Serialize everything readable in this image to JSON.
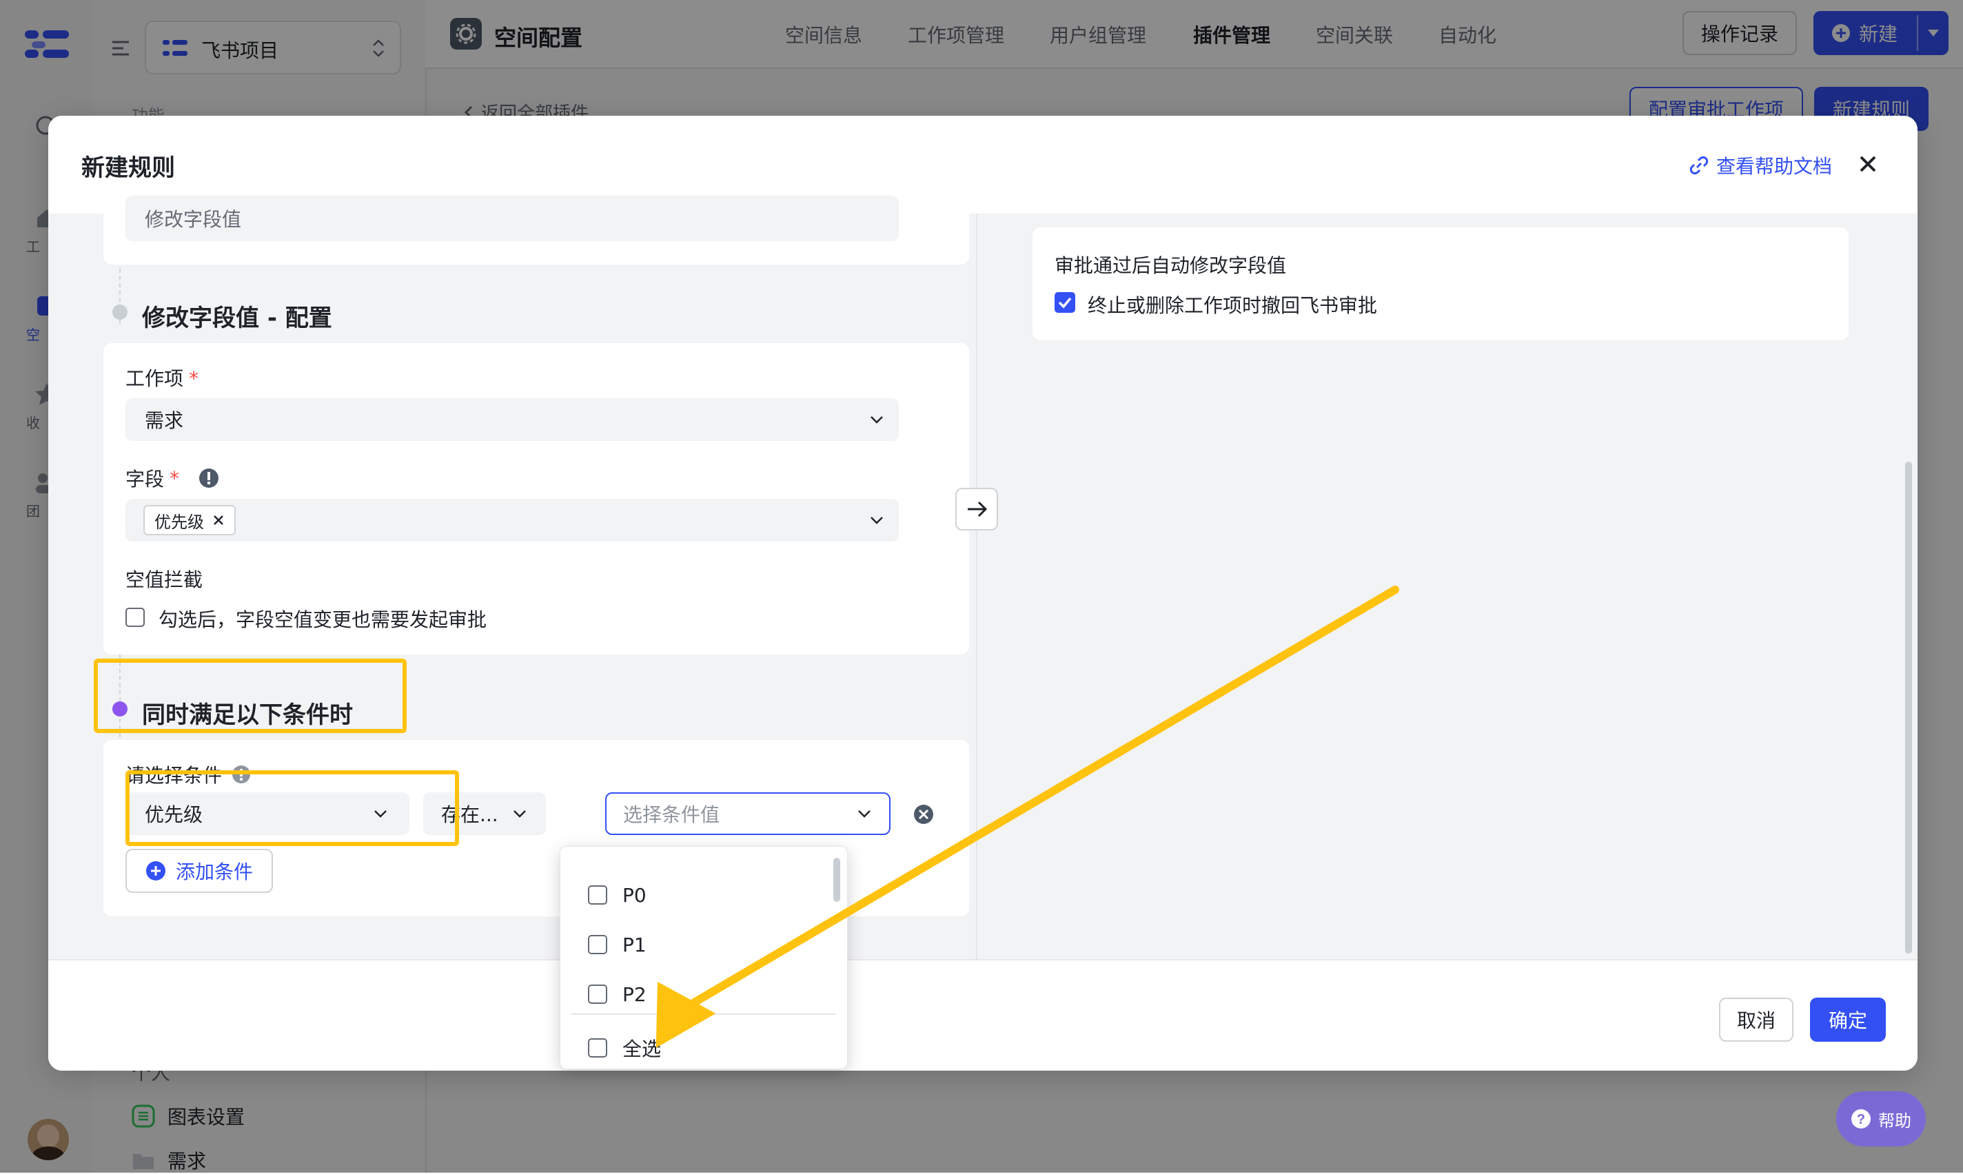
{
  "sidebar": {
    "project_name": "飞书项目",
    "section_label": "功能",
    "rail_labels": [
      "工",
      "空",
      "收",
      "团"
    ],
    "bottom_items": [
      {
        "label": "个人"
      },
      {
        "label": "图表设置"
      },
      {
        "label": "需求"
      }
    ]
  },
  "topbar": {
    "title": "空间配置",
    "tabs": [
      "空间信息",
      "工作项管理",
      "用户组管理",
      "插件管理",
      "空间关联",
      "自动化"
    ],
    "active_tab": "插件管理",
    "history_button": "操作记录",
    "new_button": "新建"
  },
  "page": {
    "back_link": "返回全部插件",
    "config_approval_button": "配置审批工作项",
    "new_rule_button": "新建规则"
  },
  "modal": {
    "title": "新建规则",
    "help_link": "查看帮助文档",
    "top_select_value": "修改字段值",
    "config_section_title": "修改字段值 - 配置",
    "work_item_label": "工作项",
    "work_item_value": "需求",
    "field_label": "字段",
    "field_tag": "优先级",
    "empty_intercept_label": "空值拦截",
    "empty_intercept_checkbox": "勾选后，字段空值变更也需要发起审批",
    "condition_section_title": "同时满足以下条件时",
    "condition_label": "请选择条件",
    "condition_field_value": "优先级",
    "operator_value": "存在...",
    "condition_value_placeholder": "选择条件值",
    "add_condition": "添加条件",
    "dropdown_options": [
      "P0",
      "P1",
      "P2"
    ],
    "select_all": "全选",
    "right_panel_title": "审批通过后自动修改字段值",
    "right_panel_checkbox": "终止或删除工作项时撤回飞书审批",
    "cancel_button": "取消",
    "confirm_button": "确定"
  },
  "floating_help": "帮助",
  "colors": {
    "primary": "#3350f5",
    "highlight": "#ffc20e",
    "purple_dot": "#8d55ed",
    "required": "#f54a45"
  }
}
